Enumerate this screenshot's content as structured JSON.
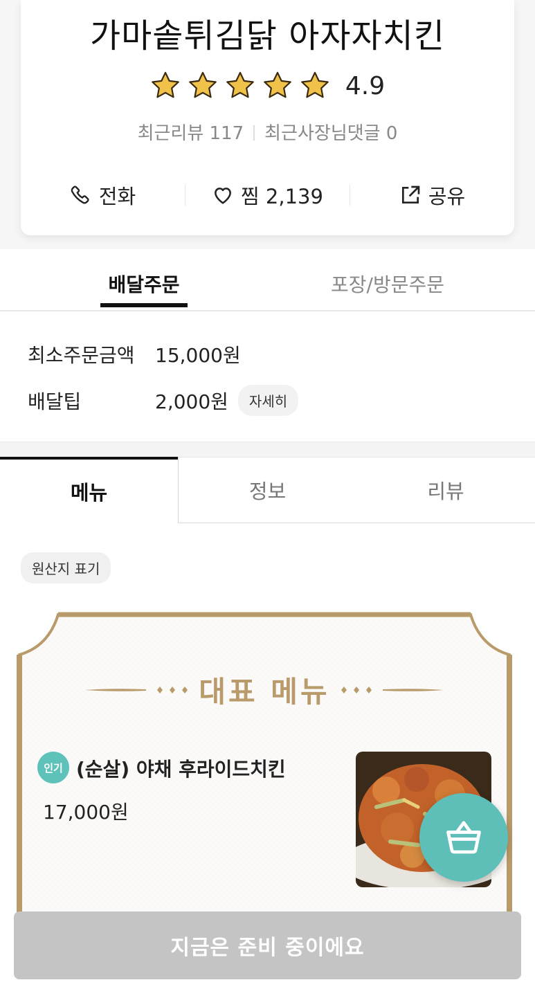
{
  "store": {
    "name": "가마솥튀김닭 아자자치킨",
    "rating": "4.9",
    "stars": 5,
    "review_text": "최근리뷰 117",
    "owner_reply_text": "최근사장님댓글 0"
  },
  "actions": {
    "call_label": "전화",
    "like_label": "찜 2,139",
    "share_label": "공유"
  },
  "order_tabs": [
    "배달주문",
    "포장/방문주문"
  ],
  "order_info": {
    "min_order_label": "최소주문금액",
    "min_order_value": "15,000원",
    "delivery_tip_label": "배달팁",
    "delivery_tip_value": "2,000원",
    "detail_label": "자세히"
  },
  "menu_tabs": [
    "메뉴",
    "정보",
    "리뷰"
  ],
  "origin_label": "원산지 표기",
  "signature": {
    "title": "대표 메뉴",
    "item": {
      "badge": "인기",
      "name": "(순살) 야채 후라이드치킨",
      "price": "17,000원"
    }
  },
  "bottom_button": "지금은 준비 중이에요",
  "colors": {
    "accent": "#5dbfb7",
    "gold": "#b99a6a",
    "star": "#f0c24a",
    "disabled": "#c4c4c4"
  },
  "icons": [
    "star-icon",
    "phone-icon",
    "heart-icon",
    "share-icon",
    "basket-icon"
  ]
}
